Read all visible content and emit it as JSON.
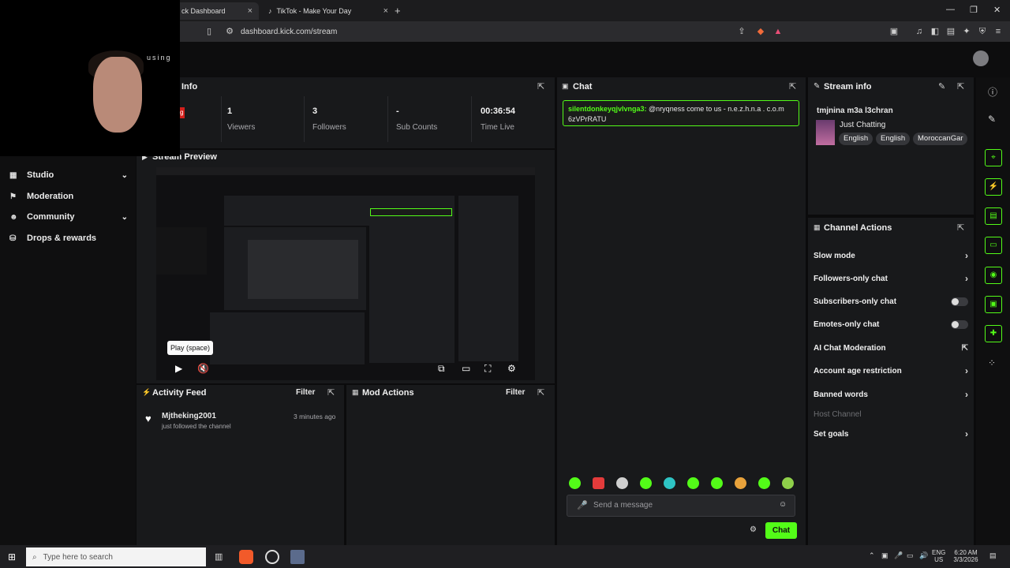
{
  "browser": {
    "tabs": [
      {
        "label": "ck Dashboard",
        "close": "×"
      },
      {
        "label": "TikTok - Make Your Day",
        "close": "×"
      }
    ],
    "new_tab": "+",
    "url": "dashboard.kick.com/stream",
    "window_controls": [
      "—",
      "❐",
      "✕"
    ]
  },
  "webcam": {
    "overlay_text": "using"
  },
  "sidebar": {
    "items": [
      {
        "label": "Studio",
        "icon": "studio-icon",
        "has_chevron": true
      },
      {
        "label": "Moderation",
        "icon": "moderation-icon",
        "has_chevron": false
      },
      {
        "label": "Community",
        "icon": "community-icon",
        "has_chevron": true
      },
      {
        "label": "Drops & rewards",
        "icon": "drops-icon",
        "has_chevron": false
      }
    ]
  },
  "session_info": {
    "title": "Info",
    "live_badge": "g",
    "stats": [
      {
        "value": "1",
        "label": "Viewers"
      },
      {
        "value": "3",
        "label": "Followers"
      },
      {
        "value": "-",
        "label": "Sub Counts"
      },
      {
        "value": "00:36:54",
        "label": "Time Live"
      }
    ]
  },
  "stream_preview": {
    "title": "Stream Preview",
    "tooltip": "Play (space)"
  },
  "activity_feed": {
    "title": "Activity Feed",
    "filter": "Filter",
    "items": [
      {
        "user": "Mjtheking2001",
        "text": "just followed the channel",
        "time": "3 minutes ago"
      }
    ]
  },
  "mod_actions": {
    "title": "Mod Actions",
    "filter": "Filter"
  },
  "chat": {
    "title": "Chat",
    "message": {
      "user": "silentdonkeyqjvlvnga3:",
      "text": "@nryqness come to us - n.e.z.h.n.a . c.o.m 6zVPrRATU"
    },
    "input_placeholder": "Send a message",
    "send_label": "Chat",
    "accent": "#53fc18"
  },
  "stream_info": {
    "title": "Stream info",
    "stream_title": "tmjnina m3a l3chran",
    "category": "Just Chatting",
    "tags": [
      "English",
      "English",
      "MoroccanGar"
    ]
  },
  "channel_actions": {
    "title": "Channel Actions",
    "items": [
      {
        "label": "Slow mode",
        "control": "arrow"
      },
      {
        "label": "Followers-only chat",
        "control": "arrow"
      },
      {
        "label": "Subscribers-only chat",
        "control": "toggle"
      },
      {
        "label": "Emotes-only chat",
        "control": "toggle"
      },
      {
        "label": "AI Chat Moderation",
        "control": "external"
      },
      {
        "label": "Account age restriction",
        "control": "arrow"
      },
      {
        "label": "Banned words",
        "control": "arrow"
      },
      {
        "label": "Host Channel",
        "control": "none"
      },
      {
        "label": "Set goals",
        "control": "arrow"
      }
    ]
  },
  "taskbar": {
    "search_placeholder": "Type here to search",
    "lang": "ENG",
    "region": "US",
    "time": "6:20 AM",
    "date": "3/3/2026"
  }
}
